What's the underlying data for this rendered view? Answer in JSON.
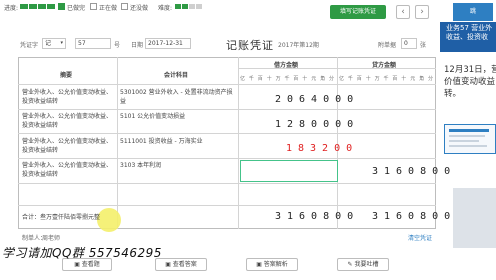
{
  "topbar": {
    "progress_label": "进度:",
    "status_done": "已做完",
    "status_doing": "正在做",
    "status_todo": "还没做",
    "difficulty_label": "难度:",
    "record_button": "填写记账凭证",
    "prev": "‹",
    "next": "›",
    "jump_label": "跳"
  },
  "voucher": {
    "voucher_word_label": "凭证字",
    "voucher_word_value": "记",
    "number_value": "57",
    "number_suffix": "号",
    "date_label": "日期",
    "date_value": "2017-12-31",
    "title": "记账凭证",
    "period": "2017年第12期",
    "attachment_label": "附单据",
    "attachment_value": "0",
    "attachment_suffix": "张"
  },
  "table": {
    "col_summary": "摘要",
    "col_account": "会计科目",
    "col_debit": "借方金额",
    "col_credit": "贷方金额",
    "units": [
      "亿",
      "千",
      "百",
      "十",
      "万",
      "千",
      "百",
      "十",
      "元",
      "角",
      "分"
    ],
    "rows": [
      {
        "summary": "营业外收入、公允价值变动收益、投资收益结转",
        "account": "5301002 营业外收入 - 处置非流动资产损益",
        "debit": "2064000",
        "debit_red": false,
        "credit": ""
      },
      {
        "summary": "营业外收入、公允价值变动收益、投资收益结转",
        "account": "5101 公允价值变动损益",
        "debit": "1280000",
        "debit_red": false,
        "credit": ""
      },
      {
        "summary": "营业外收入、公允价值变动收益、投资收益结转",
        "account": "5111001 投资收益 - 万海实业",
        "debit": "183200",
        "debit_red": true,
        "credit": ""
      },
      {
        "summary": "营业外收入、公允价值变动收益、投资收益结转",
        "account": "3103 本年利润",
        "debit": "",
        "debit_red": false,
        "credit": "3160800"
      }
    ],
    "total_label": "合计：叁万壹仟陆佰零捌元整",
    "total_debit": "3160800",
    "total_credit": "3160800",
    "maker_label": "制单人：",
    "maker_value": "周老师",
    "cleanup_label": "清空凭证"
  },
  "right_panel": {
    "header_line1": "业务57 营业外",
    "header_line2": "收益、投资收",
    "body_line1": "12月31日，营",
    "body_line2": "价值变动收益",
    "body_line3": "转。"
  },
  "watermark": "学习请加QQ群 557546295",
  "toolbar": {
    "view_question": "查看题",
    "view_answer": "查看答案",
    "answer_analysis": "答案解析",
    "feedback": "我要吐槽"
  }
}
